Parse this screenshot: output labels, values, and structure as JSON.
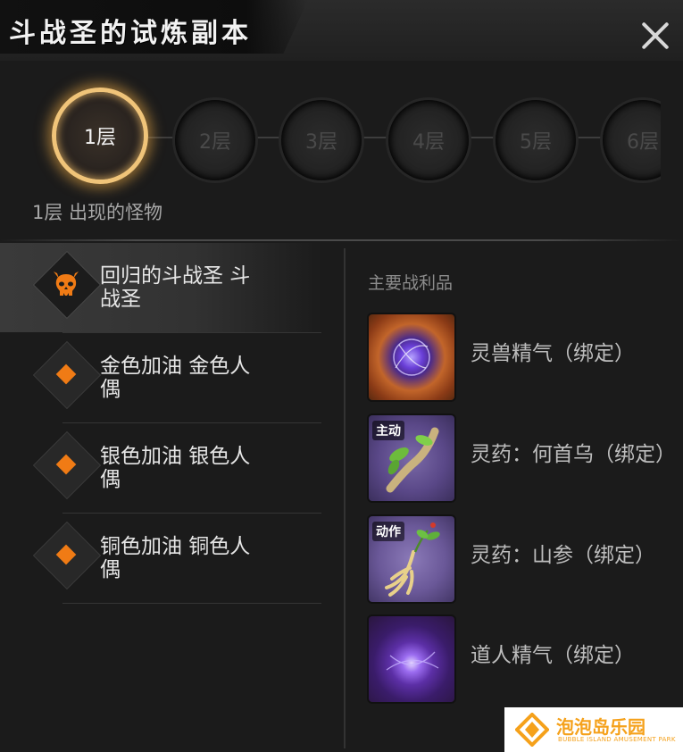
{
  "header": {
    "title": "斗战圣的试炼副本",
    "close_icon": "close-icon"
  },
  "floors": [
    {
      "label": "1层",
      "active": true
    },
    {
      "label": "2层",
      "active": false
    },
    {
      "label": "3层",
      "active": false
    },
    {
      "label": "4层",
      "active": false
    },
    {
      "label": "5层",
      "active": false
    },
    {
      "label": "6层",
      "active": false
    }
  ],
  "floor_monsters_label": "1层 出现的怪物",
  "monsters": [
    {
      "name": "回归的斗战圣 斗战圣",
      "icon": "demon-skull-icon",
      "active": true
    },
    {
      "name": "金色加油 金色人偶",
      "icon": "orange-diamond-icon",
      "active": false
    },
    {
      "name": "银色加油 银色人偶",
      "icon": "orange-diamond-icon",
      "active": false
    },
    {
      "name": "铜色加油 铜色人偶",
      "icon": "orange-diamond-icon",
      "active": false
    }
  ],
  "loot": {
    "title": "主要战利品",
    "items": [
      {
        "name": "灵兽精气（绑定）",
        "icon": "beast-essence-icon",
        "badge": ""
      },
      {
        "name": "灵药：何首乌（绑定）",
        "icon": "herb-heshouwu-icon",
        "badge": "主动"
      },
      {
        "name": "灵药：山参（绑定）",
        "icon": "herb-ginseng-icon",
        "badge": "动作"
      },
      {
        "name": "道人精气（绑定）",
        "icon": "taoist-essence-icon",
        "badge": ""
      }
    ]
  },
  "watermark": {
    "text": "泡泡岛乐园",
    "sub": "BUBBLE ISLAND AMUSEMENT PARK"
  },
  "colors": {
    "accent": "#f07b15",
    "ring": "#f0c479",
    "watermark": "#f5a11b"
  }
}
